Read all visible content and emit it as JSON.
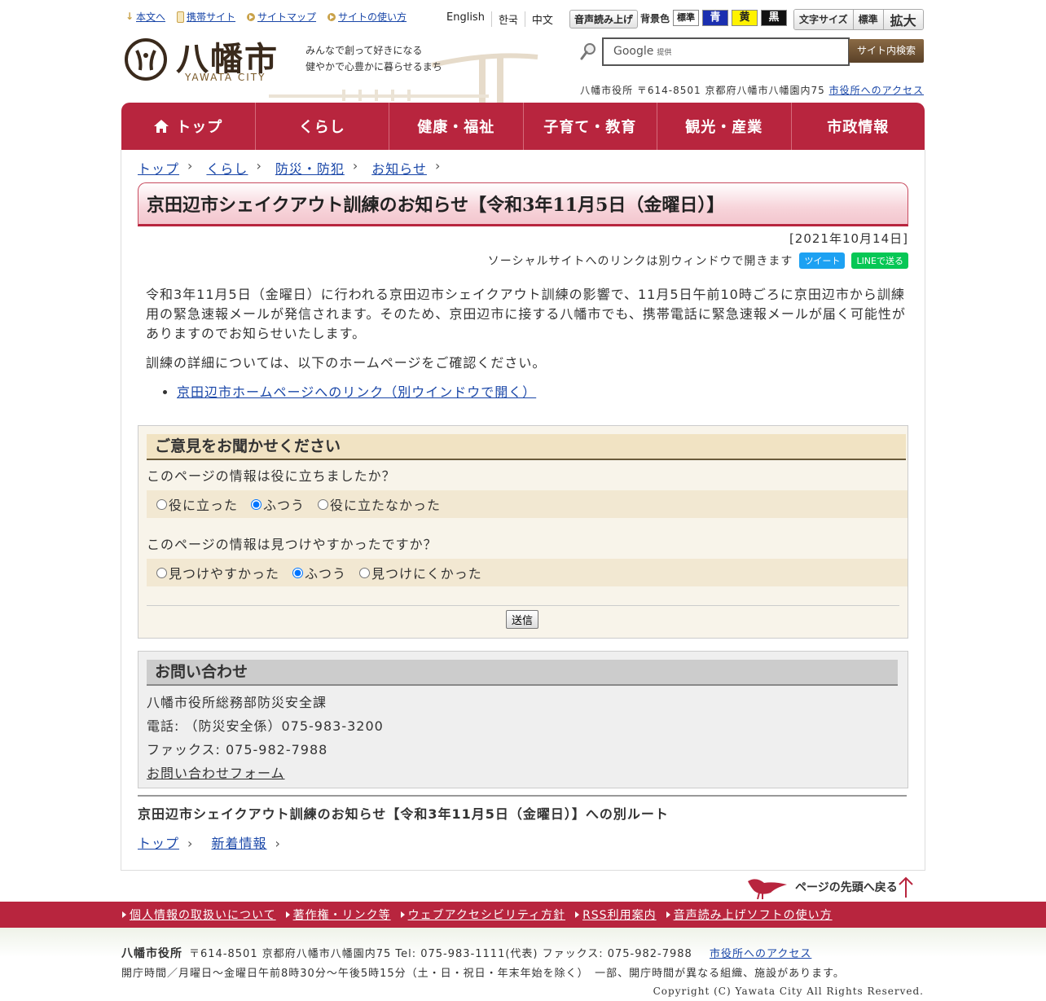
{
  "util": {
    "links": [
      "本文へ",
      "携帯サイト",
      "サイトマップ",
      "サイトの使い方"
    ],
    "langs": [
      "English",
      "한국",
      "中文"
    ],
    "voice": "音声読み上げ",
    "bg_label": "背景色",
    "bg_options": [
      "標準",
      "青",
      "黄",
      "黒"
    ],
    "font_label": "文字サイズ",
    "font_options": [
      "標準",
      "拡大"
    ]
  },
  "header": {
    "logo_name": "八幡市",
    "logo_en": "YAWATA CITY",
    "tagline1": "みんなで創って好きになる",
    "tagline2": "健やかで心豊かに暮らせるまち",
    "search_brand": "Google",
    "search_brand_sub": "提供",
    "search_button": "サイト内検索",
    "address": "八幡市役所 〒614-8501 京都府八幡市八幡園内75",
    "access_link": "市役所へのアクセス"
  },
  "gnav": [
    "トップ",
    "くらし",
    "健康・福祉",
    "子育て・教育",
    "観光・産業",
    "市政情報"
  ],
  "breadcrumb": [
    "トップ",
    "くらし",
    "防災・防犯",
    "お知らせ"
  ],
  "article": {
    "title": "京田辺市シェイクアウト訓練のお知らせ【令和3年11月5日（金曜日）】",
    "date": "[2021年10月14日]",
    "social_note": "ソーシャルサイトへのリンクは別ウィンドウで開きます",
    "tweet": "ツイート",
    "line": "LINEで送る",
    "para1": "令和3年11月5日（金曜日）に行われる京田辺市シェイクアウト訓練の影響で、11月5日午前10時ごろに京田辺市から訓練用の緊急速報メールが発信されます。そのため、京田辺市に接する八幡市でも、携帯電話に緊急速報メールが届く可能性がありますのでお知らせいたします。",
    "para2": "訓練の詳細については、以下のホームページをご確認ください。",
    "link": "京田辺市ホームページへのリンク（別ウインドウで開く）"
  },
  "feedback": {
    "heading": "ご意見をお聞かせください",
    "q1": "このページの情報は役に立ちましたか？",
    "q1_options": [
      "役に立った",
      "ふつう",
      "役に立たなかった"
    ],
    "q2": "このページの情報は見つけやすかったですか？",
    "q2_options": [
      "見つけやすかった",
      "ふつう",
      "見つけにくかった"
    ],
    "submit": "送信"
  },
  "contact": {
    "heading": "お問い合わせ",
    "dept": "八幡市役所総務部防災安全課",
    "tel": "電話: （防災安全係）075-983-3200",
    "fax": "ファックス: 075-982-7988",
    "form_link": "お問い合わせフォーム"
  },
  "alt_route": {
    "title": "京田辺市シェイクアウト訓練のお知らせ【令和3年11月5日（金曜日）】への別ルート",
    "crumbs": [
      "トップ",
      "新着情報"
    ]
  },
  "footer": {
    "pagetop": "ページの先頭へ戻る",
    "links": [
      "個人情報の取扱いについて",
      "著作権・リンク等",
      "ウェブアクセシビリティ方針",
      "RSS利用案内",
      "音声読み上げソフトの使い方"
    ],
    "org": "八幡市役所",
    "line1": "〒614-8501 京都府八幡市八幡園内75  Tel: 075-983-1111(代表) ファックス: 075-982-7988",
    "access_link": "市役所へのアクセス",
    "hours": "開庁時間／月曜日～金曜日午前8時30分～午後5時15分（土・日・祝日・年末年始を除く）　一部、開庁時間が異なる組織、施設があります。",
    "copyright": "Copyright (C) Yawata City All Rights Reserved."
  }
}
